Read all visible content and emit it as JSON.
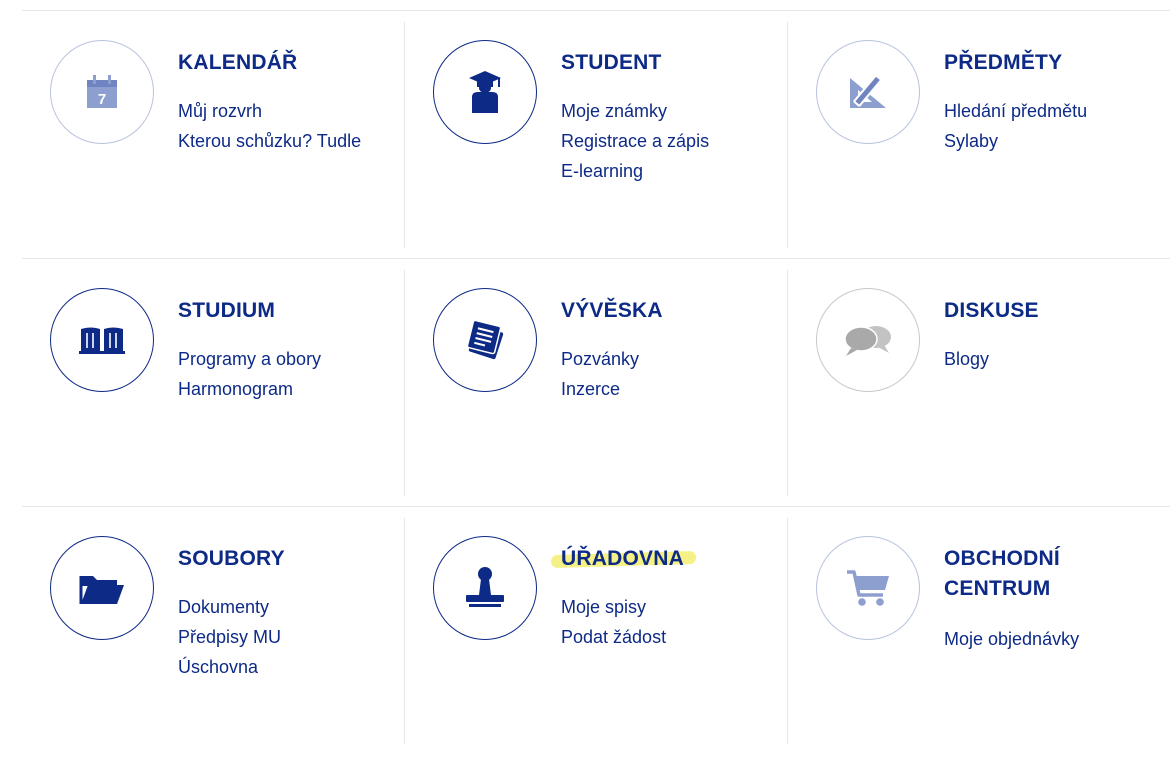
{
  "tiles": [
    {
      "title": "KALENDÁŘ",
      "icon": "calendar-icon",
      "links": [
        "Můj rozvrh",
        "Kterou schůzku? Tudle"
      ]
    },
    {
      "title": "STUDENT",
      "icon": "student-icon",
      "links": [
        "Moje známky",
        "Registrace a zápis",
        "E-learning"
      ]
    },
    {
      "title": "PŘEDMĚTY",
      "icon": "ruler-pencil-icon",
      "links": [
        "Hledání předmětu",
        "Sylaby"
      ]
    },
    {
      "title": "STUDIUM",
      "icon": "book-icon",
      "links": [
        "Programy a obory",
        "Harmonogram"
      ]
    },
    {
      "title": "VÝVĚSKA",
      "icon": "notes-icon",
      "links": [
        "Pozvánky",
        "Inzerce"
      ]
    },
    {
      "title": "DISKUSE",
      "icon": "chat-bubbles-icon",
      "links": [
        "Blogy"
      ]
    },
    {
      "title": "SOUBORY",
      "icon": "folder-icon",
      "links": [
        "Dokumenty",
        "Předpisy MU",
        "Úschovna"
      ]
    },
    {
      "title": "ÚŘADOVNA",
      "icon": "stamp-icon",
      "links": [
        "Moje spisy",
        "Podat žádost"
      ]
    },
    {
      "title": "OBCHODNÍ CENTRUM",
      "icon": "shopping-cart-icon",
      "links": [
        "Moje objednávky"
      ]
    }
  ],
  "colors": {
    "primary": "#0d2a86",
    "light_icon": "#8d9fcf",
    "grey_icon": "#b5b5b5",
    "highlight": "#f4f07a",
    "divider": "#e4e7ee"
  }
}
